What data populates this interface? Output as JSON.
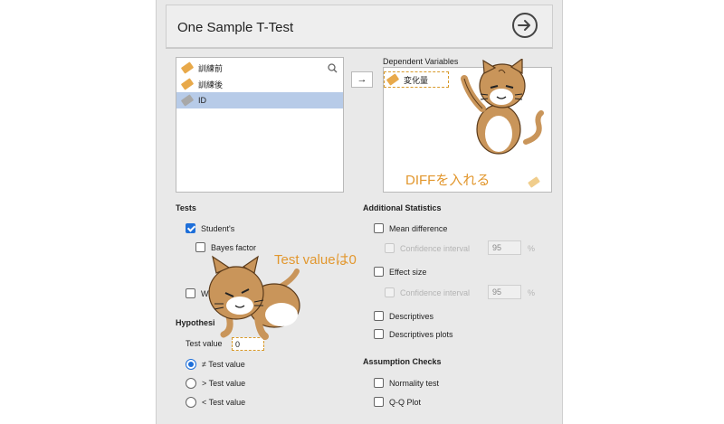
{
  "header": {
    "title": "One Sample T-Test",
    "run_icon": "arrow-right-circle-icon"
  },
  "variables": {
    "items": [
      {
        "name": "訓練前",
        "icon": "scale-icon",
        "selected": false
      },
      {
        "name": "訓練後",
        "icon": "scale-icon",
        "selected": false
      },
      {
        "name": "ID",
        "icon": "nominal-icon",
        "selected": true
      }
    ]
  },
  "assign": {
    "arrow": "→"
  },
  "dependent": {
    "label": "Dependent Variables",
    "items": [
      "変化量"
    ]
  },
  "tests": {
    "heading": "Tests",
    "students": "Student's",
    "bayes": "Bayes factor",
    "wilcoxon_partial": "W"
  },
  "hypothesis": {
    "heading_partial": "Hypothesi",
    "test_value_label": "Test value",
    "test_value": "0",
    "options": [
      "≠ Test value",
      "> Test value",
      "< Test value"
    ],
    "selected_index": 0
  },
  "additional": {
    "heading": "Additional Statistics",
    "mean_difference": "Mean difference",
    "ci_label": "Confidence interval",
    "ci_value_1": "95",
    "effect_size": "Effect size",
    "ci_value_2": "95",
    "pct": "%",
    "descriptives": "Descriptives",
    "descriptives_plots": "Descriptives plots"
  },
  "assumptions": {
    "heading": "Assumption Checks",
    "normality": "Normality test",
    "qq": "Q-Q Plot"
  },
  "annotations": {
    "diff": "DIFFを入れる",
    "test_value": "Test valueは0"
  },
  "colors": {
    "accent": "#1e6fd9",
    "annotation": "#e2972e",
    "cat_fur": "#c9955a"
  }
}
